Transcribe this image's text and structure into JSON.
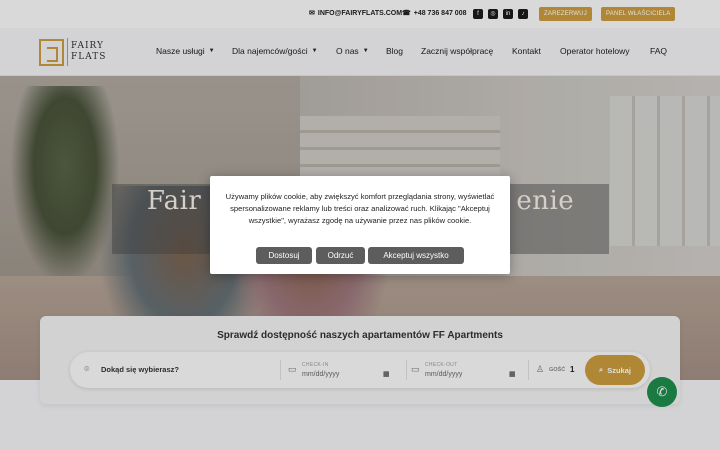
{
  "topbar": {
    "email": "INFO@FAIRYFLATS.COM",
    "phone": "+48 736 847 008",
    "socials": [
      {
        "icon": "facebook-icon",
        "glyph": "f"
      },
      {
        "icon": "instagram-icon",
        "glyph": "◎"
      },
      {
        "icon": "linkedin-icon",
        "glyph": "in"
      },
      {
        "icon": "tiktok-icon",
        "glyph": "♪"
      }
    ],
    "book_label": "ZAREZERWUJ",
    "owner_panel_label": "PANEL WŁAŚCICIELA"
  },
  "logo": {
    "line1": "FAIRY",
    "line2": "FLATS"
  },
  "nav": {
    "items": [
      {
        "label": "Nasze usługi",
        "has_dropdown": true
      },
      {
        "label": "Dla najemców/gości",
        "has_dropdown": true
      },
      {
        "label": "O nas",
        "has_dropdown": true
      },
      {
        "label": "Blog",
        "has_dropdown": false
      },
      {
        "label": "Zacznij współpracę",
        "has_dropdown": false
      },
      {
        "label": "Kontakt",
        "has_dropdown": false
      },
      {
        "label": "Operator hotelowy",
        "has_dropdown": false
      },
      {
        "label": "FAQ",
        "has_dropdown": false
      }
    ]
  },
  "hero": {
    "title_left": "Fair",
    "title_right": "enie"
  },
  "search": {
    "title": "Sprawdź dostępność naszych apartamentów FF Apartments",
    "destination_placeholder": "Dokąd się wybierasz?",
    "checkin_label": "CHECK-IN",
    "checkin_value": "mm/dd/yyyy",
    "checkout_label": "CHECK-OUT",
    "checkout_value": "mm/dd/yyyy",
    "guests_label": "GOŚĆ",
    "guests_value": "1",
    "button_label": "Szukaj"
  },
  "cookie": {
    "text": "Używamy plików cookie, aby zwiększyć komfort przeglądania strony, wyświetlać spersonalizowane reklamy lub treści oraz analizować ruch. Klikając \"Akceptuj wszystkie\", wyrażasz zgodę na używanie przez nas plików cookie.",
    "customize_label": "Dostosuj",
    "reject_label": "Odrzuć",
    "accept_label": "Akceptuj wszystko"
  },
  "colors": {
    "accent": "#c99a3d",
    "phone_fab": "#1f8a4c",
    "cookie_button": "#5d5d5d"
  }
}
